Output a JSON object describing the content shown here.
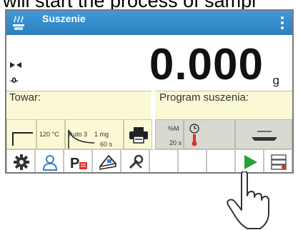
{
  "caption": "will start the process of sampl",
  "titlebar": {
    "title": "Suszenie"
  },
  "display": {
    "reading": "0.000",
    "unit": "g",
    "zero_indicator": "-0-"
  },
  "info": {
    "product_label": "Towar:",
    "program_label": "Program suszenia:"
  },
  "widgets": {
    "drying_temp": "120 °C",
    "mode": "Auto 3",
    "mode_threshold": "1 mg",
    "mode_time": "60 s",
    "result_unit": "%M",
    "interval": "20 s"
  },
  "toolbar": {
    "buttons": [
      {
        "icon": "gear-icon"
      },
      {
        "icon": "user-icon"
      },
      {
        "icon": "profile-p-icon"
      },
      {
        "icon": "weighing-pan-icon"
      },
      {
        "icon": "tools-icon"
      },
      {
        "icon": "empty"
      },
      {
        "icon": "empty"
      },
      {
        "icon": "empty"
      },
      {
        "icon": "start-play-icon"
      },
      {
        "icon": "database-icon"
      }
    ]
  },
  "colors": {
    "titlebar": "#2d7fc0",
    "info_bg": "#fbf8d6",
    "play_green": "#22a33a",
    "accent_red": "#d9342b"
  }
}
